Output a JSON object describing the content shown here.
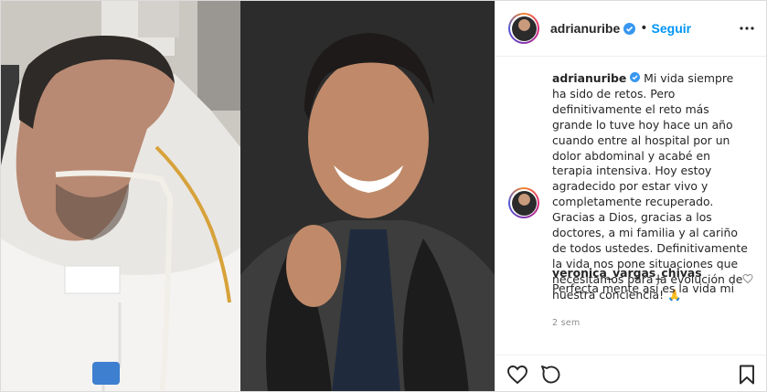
{
  "post": {
    "author": {
      "username": "adrianuribe",
      "verified": true,
      "follow_label": "Seguir",
      "separator": "•"
    },
    "caption": {
      "username": "adrianuribe",
      "text": "Mi vida siempre ha sido de retos. Pero definitivamente el reto más grande lo tuve hoy hace un año cuando entre al hospital por un dolor abdominal y acabé en terapia intensiva. Hoy estoy agradecido por estar vivo y completamente recuperado. Gracias a Dios, gracias a los doctores, a mi familia y al cariño de todos ustedes. Definitivamente la vida nos pone situaciones que necesitamos para la evolución de nuestra conciencia! 🙏"
    },
    "time_ago": "2 sem",
    "comments": [
      {
        "username": "veronica_vargas_chivas",
        "text": "Perfecta mente así es la vida mi"
      }
    ],
    "media": {
      "left_photo": "hospital-photo",
      "right_photo": "portrait-photo"
    },
    "icons": {
      "like": "heart-icon",
      "comment": "comment-icon",
      "save": "bookmark-icon",
      "more": "more-options-icon",
      "verified": "verified-badge-icon"
    },
    "colors": {
      "follow": "#0095f6",
      "verified": "#3897f0",
      "text": "#262626",
      "muted": "#8e8e8e",
      "border": "#efefef"
    }
  }
}
